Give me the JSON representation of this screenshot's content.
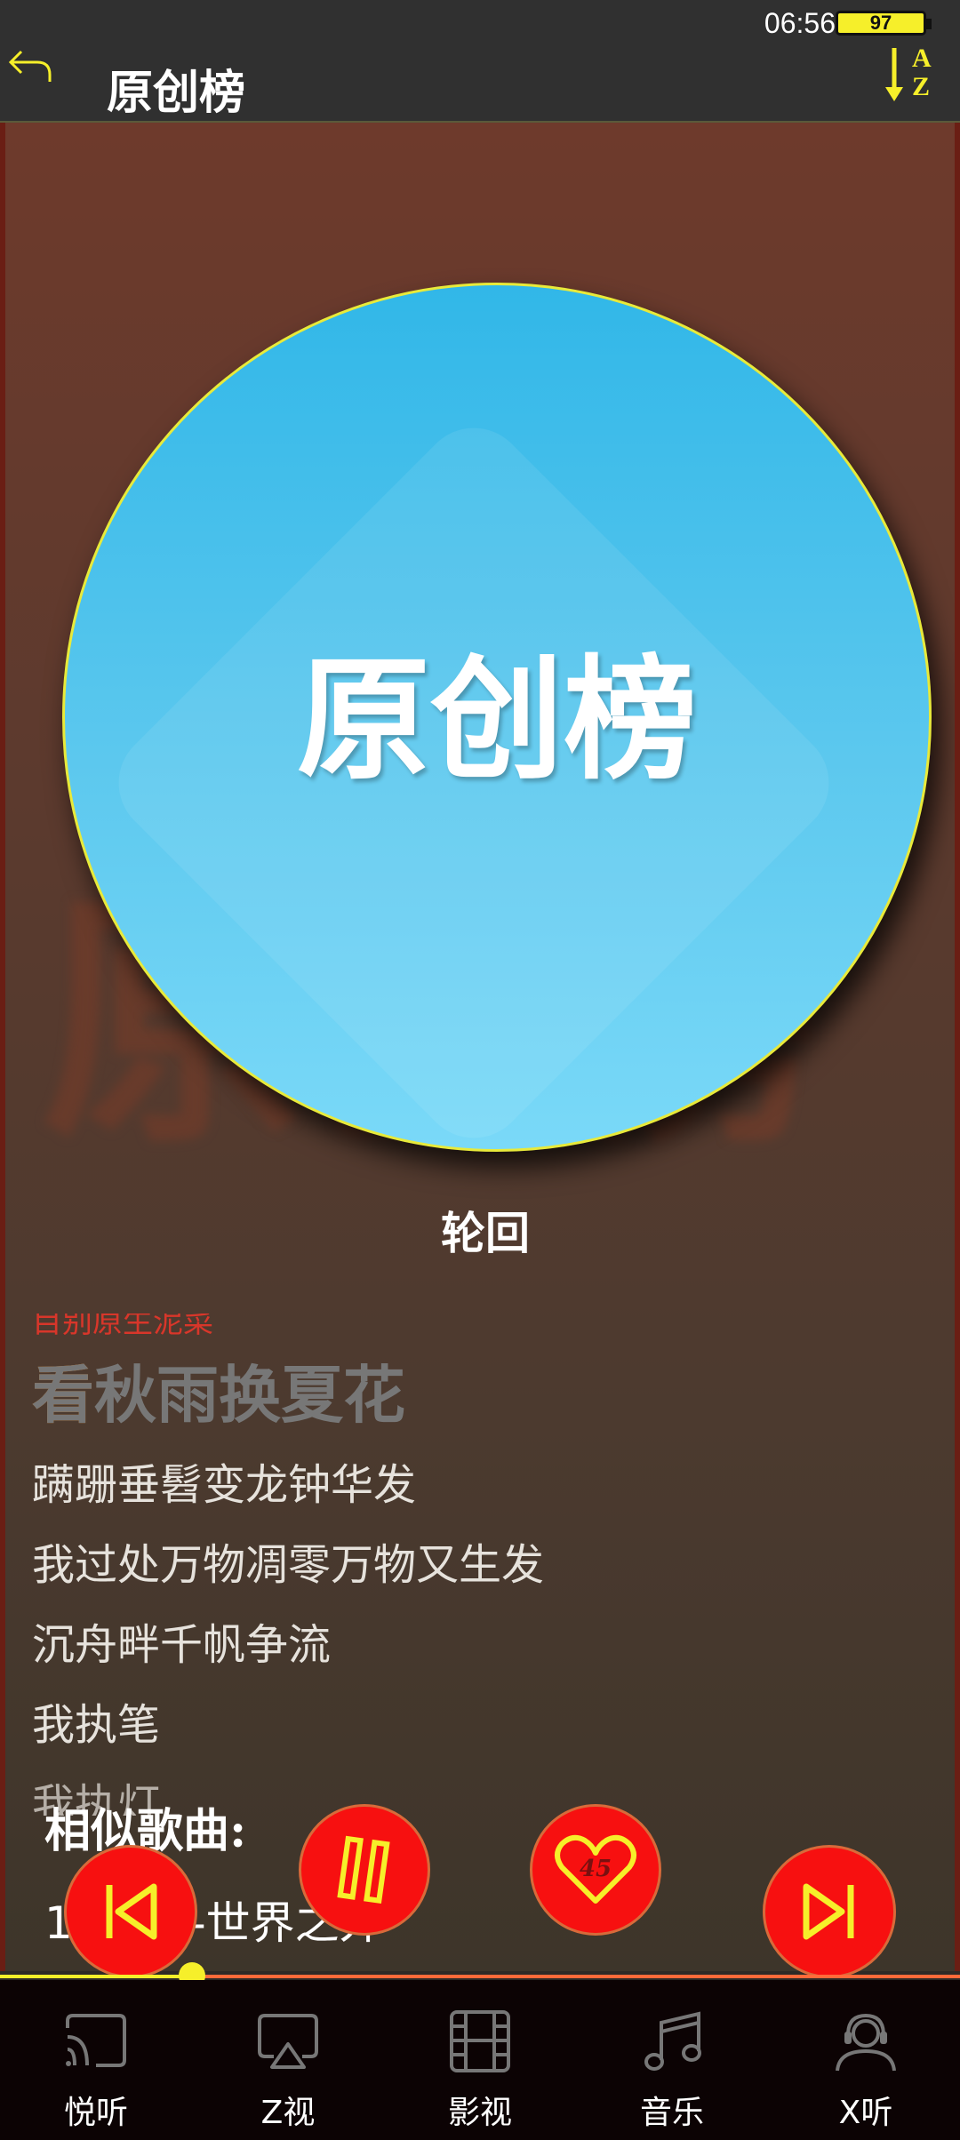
{
  "status": {
    "time": "06:56",
    "battery": "97"
  },
  "header": {
    "title": "原创榜",
    "sort_label_top": "A",
    "sort_label_bottom": "Z"
  },
  "album": {
    "cover_text": "原创榜",
    "ghost_text": "原创榜"
  },
  "player": {
    "song_title": "轮回",
    "lyrics": {
      "previous": "目别原生泥菜",
      "current_highlight": "看",
      "current_rest": "看秋雨换夏花",
      "lines": [
        "蹒跚垂髫变龙钟华发",
        "我过处万物凋零万物又生发",
        "沉舟畔千帆争流",
        "我执笔",
        "我执灯"
      ]
    },
    "like_count": "45",
    "progress": 0.2
  },
  "similar": {
    "title": "相似歌曲:",
    "item": "1. 闪烁-世界之外"
  },
  "bottom_nav": [
    {
      "label": "悦听",
      "icon": "cast-icon"
    },
    {
      "label": "Z视",
      "icon": "airplay-icon"
    },
    {
      "label": "影视",
      "icon": "film-icon"
    },
    {
      "label": "音乐",
      "icon": "music-note-icon"
    },
    {
      "label": "X听",
      "icon": "headset-person-icon"
    }
  ],
  "colors": {
    "accent": "#f6ef2a",
    "button_red": "#f71010",
    "album_blue": "#31b7e8"
  }
}
